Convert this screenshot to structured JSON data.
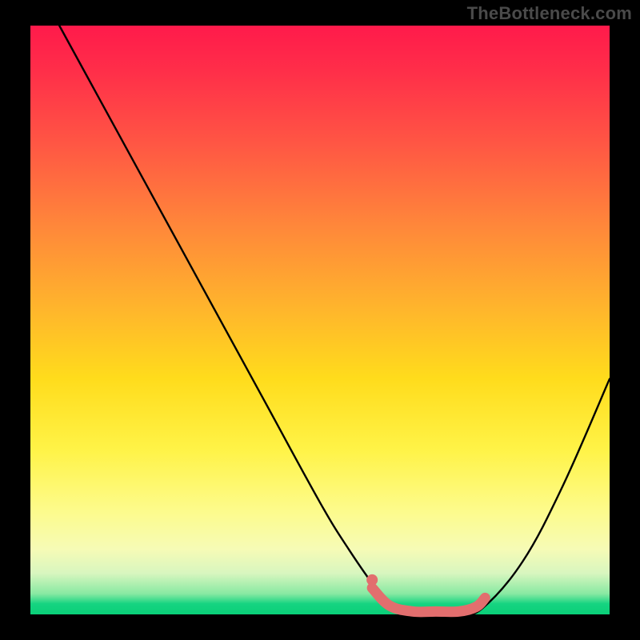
{
  "watermark": "TheBottleneck.com",
  "chart_data": {
    "type": "line",
    "title": "",
    "xlabel": "",
    "ylabel": "",
    "xlim": [
      0,
      100
    ],
    "ylim": [
      0,
      100
    ],
    "series": [
      {
        "name": "bottleneck-curve",
        "x": [
          5,
          10,
          20,
          30,
          40,
          50,
          55,
          60,
          63,
          66,
          70,
          74,
          78,
          85,
          92,
          100
        ],
        "y": [
          100,
          91,
          73,
          55,
          37,
          19,
          11,
          4,
          1,
          0,
          0,
          0,
          1,
          9,
          22,
          40
        ]
      }
    ],
    "highlight": {
      "name": "optimal-range",
      "x": [
        59,
        62,
        66,
        70,
        74,
        77,
        78.5
      ],
      "y": [
        4.5,
        1.5,
        0.5,
        0.5,
        0.5,
        1.3,
        2.8
      ]
    },
    "colors": {
      "curve": "#000000",
      "highlight": "#e26e6e",
      "gradient_top": "#ff1a4b",
      "gradient_bottom": "#0acf78"
    }
  }
}
